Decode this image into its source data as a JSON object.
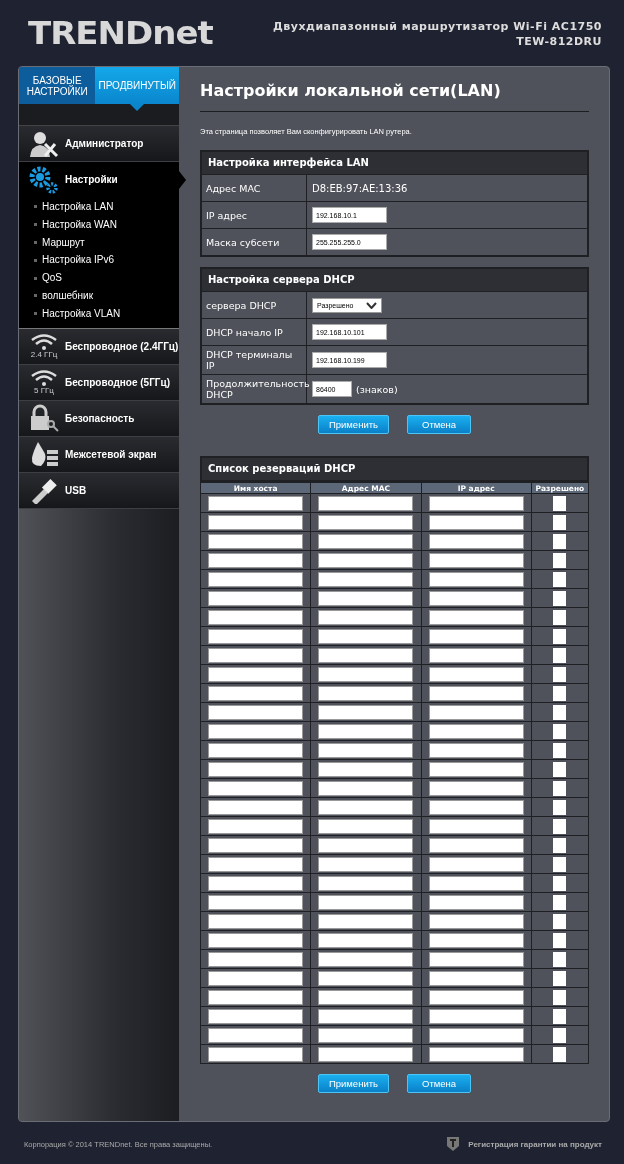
{
  "header": {
    "logo": "TRENDnet",
    "product": "Двухдиапазонный маршрутизатор Wi-Fi AC1750",
    "model": "TEW-812DRU"
  },
  "tabs": [
    {
      "label": "БАЗОВЫЕ НАСТРОЙКИ",
      "selected": false
    },
    {
      "label": "ПРОДВИНУТЫЙ",
      "selected": true
    }
  ],
  "sidebar": {
    "items": [
      {
        "label": "Администратор",
        "selected": false
      },
      {
        "label": "Настройки",
        "selected": true,
        "children": [
          {
            "label": "Настройка LAN"
          },
          {
            "label": "Настройка WAN"
          },
          {
            "label": "Маршрут"
          },
          {
            "label": "Настройка IPv6"
          },
          {
            "label": "QoS"
          },
          {
            "label": "волшебник"
          },
          {
            "label": "Настройка VLAN"
          }
        ]
      },
      {
        "label": "Беспроводное (2.4ГГц)",
        "selected": false,
        "icon_caption": "2.4 ГГц"
      },
      {
        "label": "Беспроводное (5ГГц)",
        "selected": false,
        "icon_caption": "5 ГГц"
      },
      {
        "label": "Безопасность",
        "selected": false
      },
      {
        "label": "Межсетевой экран",
        "selected": false
      },
      {
        "label": "USB",
        "selected": false
      }
    ]
  },
  "page": {
    "title": "Настройки локальной сети(LAN)",
    "description": "Эта страница позволяет Вам сконфигурировать LAN рутера."
  },
  "lan_section": {
    "title": "Настройка интерфейса LAN",
    "rows": [
      {
        "kind": "text",
        "label": "Адрес MAC",
        "value": "D8:EB:97:AE:13:36"
      },
      {
        "kind": "input",
        "label": "IP адрес",
        "value": "192.168.10.1"
      },
      {
        "kind": "input",
        "label": "Маска субсети",
        "value": "255.255.255.0"
      }
    ]
  },
  "dhcp_section": {
    "title": "Настройка сервера DHCP",
    "rows": [
      {
        "kind": "select",
        "label": "сервера DHCP",
        "value": "Разрешено"
      },
      {
        "kind": "input",
        "label": "DHCP начало IP",
        "value": "192.168.10.101"
      },
      {
        "kind": "input",
        "label": "DHCP терминалы IP",
        "value": "192.168.10.199"
      },
      {
        "kind": "short_input",
        "label": "Продолжительность DHCP",
        "value": "86400",
        "suffix": "(знаков)"
      }
    ]
  },
  "buttons_top": [
    "Применить",
    "Отмена"
  ],
  "reservations": {
    "title": "Список резерваций DHCP",
    "columns": [
      "Имя хоста",
      "Адрес MAC",
      "IP адрес",
      "Разрешено"
    ],
    "rows": [
      {
        "enabled": false
      },
      {
        "enabled": false
      },
      {
        "enabled": false
      },
      {
        "enabled": false
      },
      {
        "enabled": false
      },
      {
        "enabled": false
      },
      {
        "enabled": false
      },
      {
        "enabled": false
      },
      {
        "enabled": false
      },
      {
        "enabled": false
      },
      {
        "enabled": false
      },
      {
        "enabled": false
      },
      {
        "enabled": false
      },
      {
        "enabled": false
      },
      {
        "enabled": false
      },
      {
        "enabled": false
      },
      {
        "enabled": false
      },
      {
        "enabled": false
      },
      {
        "enabled": false
      },
      {
        "enabled": false
      },
      {
        "enabled": false
      },
      {
        "enabled": false
      },
      {
        "enabled": false
      },
      {
        "enabled": false
      },
      {
        "enabled": false
      },
      {
        "enabled": false
      },
      {
        "enabled": false
      },
      {
        "enabled": false
      },
      {
        "enabled": false
      },
      {
        "enabled": false
      }
    ]
  },
  "buttons_bottom": [
    "Применить",
    "Отмена"
  ],
  "footer": {
    "copyright": "Корпорация © 2014 TRENDnet. Все права защищены.",
    "warranty_link": "Регистрация гарантии на продукт"
  }
}
